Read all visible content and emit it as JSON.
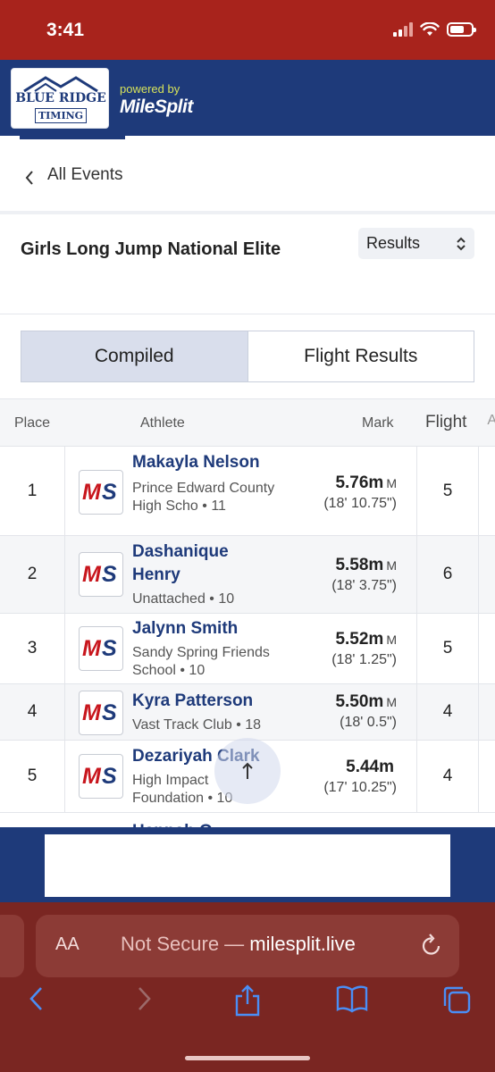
{
  "status_bar": {
    "time": "3:41"
  },
  "header": {
    "logo_line1": "BLUE RIDGE",
    "logo_line2": "TIMING",
    "powered_by": "powered by",
    "brand": "MileSplit"
  },
  "nav": {
    "back_label": "All Events"
  },
  "event": {
    "title": "Girls Long Jump National Elite",
    "view_select": "Results"
  },
  "tabs": [
    {
      "label": "Compiled",
      "active": true
    },
    {
      "label": "Flight Results",
      "active": false
    }
  ],
  "table": {
    "headers": {
      "place": "Place",
      "athlete": "Athlete",
      "mark": "Mark",
      "flight": "Flight",
      "more": "A"
    },
    "rows": [
      {
        "place": "1",
        "name": "Makayla Nelson",
        "team": "Prince Edward County High Scho • 11",
        "mark": "5.76m",
        "unit": "M",
        "imperial": "(18' 10.75\")",
        "flight": "5"
      },
      {
        "place": "2",
        "name": "Dashanique Henry",
        "team": "Unattached • 10",
        "mark": "5.58m",
        "unit": "M",
        "imperial": "(18' 3.75\")",
        "flight": "6"
      },
      {
        "place": "3",
        "name": "Jalynn Smith",
        "team": "Sandy Spring Friends School • 10",
        "mark": "5.52m",
        "unit": "M",
        "imperial": "(18' 1.25\")",
        "flight": "5"
      },
      {
        "place": "4",
        "name": "Kyra Patterson",
        "team": "Vast Track Club • 18",
        "mark": "5.50m",
        "unit": "M",
        "imperial": "(18' 0.5\")",
        "flight": "4"
      },
      {
        "place": "5",
        "name": "Dezariyah Clark",
        "team": "High Impact Foundation • 10",
        "mark": "5.44m",
        "unit": "",
        "imperial": "(17' 10.25\")",
        "flight": "4"
      }
    ],
    "next_row_peek": "Hannah O..."
  },
  "avatar_logo": {
    "m": "M",
    "s": "S"
  },
  "browser": {
    "aa_label": "AA",
    "url_prefix": "Not Secure — ",
    "url_domain": "milesplit.live"
  },
  "colors": {
    "status_bar": "#a8231c",
    "brand_navy": "#1e3a7a",
    "safari_bar": "#7a2622",
    "ms_red": "#c8161d"
  },
  "icons": {
    "back": "chevron-left-icon",
    "select": "chevron-up-down-icon",
    "scroll_top": "arrow-up-icon",
    "reload": "reload-icon",
    "share": "share-icon",
    "bookmarks": "book-icon",
    "tabs": "tabs-icon"
  }
}
